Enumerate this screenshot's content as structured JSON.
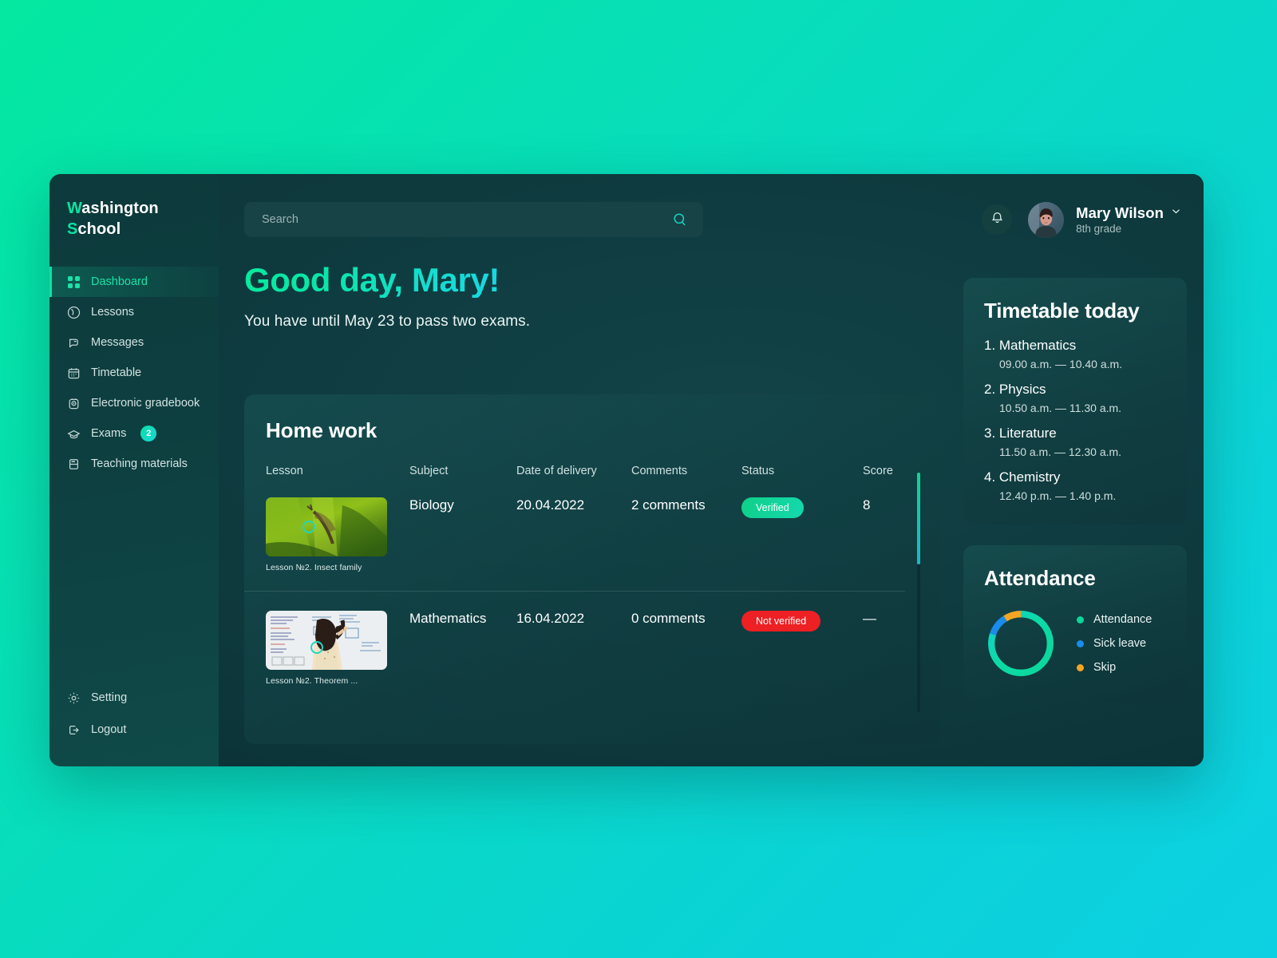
{
  "brand": {
    "line1": "Washington",
    "line2": "School",
    "accent1": "W",
    "accent2": "S",
    "accent_color": "#07e5a4"
  },
  "sidebar": {
    "items": [
      {
        "label": "Dashboard",
        "icon": "grid-icon",
        "active": true
      },
      {
        "label": "Lessons",
        "icon": "lessons-icon",
        "active": false
      },
      {
        "label": "Messages",
        "icon": "message-icon",
        "active": false
      },
      {
        "label": "Timetable",
        "icon": "calendar-icon",
        "active": false
      },
      {
        "label": "Electronic gradebook",
        "icon": "gradebook-icon",
        "active": false
      },
      {
        "label": "Exams",
        "icon": "graduation-cap-icon",
        "active": false,
        "badge": "2"
      },
      {
        "label": "Teaching materials",
        "icon": "book-icon",
        "active": false
      }
    ],
    "bottom_items": [
      {
        "label": "Setting",
        "icon": "gear-icon"
      },
      {
        "label": "Logout",
        "icon": "logout-icon"
      }
    ]
  },
  "search": {
    "placeholder": "Search",
    "value": "",
    "icon": "search-icon"
  },
  "header": {
    "bell_icon": "bell-icon",
    "user": {
      "name": "Mary Wilson",
      "grade": "8th grade",
      "chevron": "chevron-down-icon",
      "avatar": "avatar"
    }
  },
  "greeting": {
    "title": "Good day, Mary!",
    "subtitle": "You have until May 23 to pass two exams."
  },
  "homework": {
    "title": "Home work",
    "columns": [
      "Lesson",
      "Subject",
      "Date of delivery",
      "Comments",
      "Status",
      "Score"
    ],
    "rows": [
      {
        "lesson_caption": "Lesson №2. Insect family",
        "lesson_thumb": "insect-photo",
        "subject": "Biology",
        "date": "20.04.2022",
        "comments": "2 comments",
        "status": "Verified",
        "status_kind": "verified",
        "score": "8"
      },
      {
        "lesson_caption": "Lesson №2. Theorem ...",
        "lesson_thumb": "whiteboard-photo",
        "subject": "Mathematics",
        "date": "16.04.2022",
        "comments": "0 comments",
        "status": "Not verified",
        "status_kind": "notverified",
        "score": "—"
      }
    ]
  },
  "timetable": {
    "title": "Timetable today",
    "items": [
      {
        "name": "1. Mathematics",
        "time": "09.00 a.m. — 10.40 a.m."
      },
      {
        "name": "2. Physics",
        "time": "10.50 a.m. — 11.30 a.m."
      },
      {
        "name": "3. Literature",
        "time": "11.50 a.m. — 12.30 a.m."
      },
      {
        "name": "4. Chemistry",
        "time": "12.40 p.m. — 1.40 p.m."
      }
    ]
  },
  "attendance": {
    "title": "Attendance",
    "legend": [
      {
        "label": "Attendance",
        "color": "#0bd79a"
      },
      {
        "label": "Sick leave",
        "color": "#1a8ceb"
      },
      {
        "label": "Skip",
        "color": "#f5a524"
      }
    ]
  },
  "colors": {
    "accent_green": "#07e5a4",
    "accent_cyan": "#17d9e2",
    "panel": "#0e3a3e",
    "sidebar": "#0e4140",
    "danger": "#ed2024",
    "success": "#10cf87"
  },
  "chart_data": {
    "type": "pie",
    "title": "Attendance",
    "labels": [
      "Attendance",
      "Sick leave",
      "Skip"
    ],
    "values": [
      80,
      11,
      9
    ],
    "colors": [
      "#0bd79a",
      "#1a8ceb",
      "#f5a524"
    ],
    "donut": true,
    "inner_radius_ratio": 0.78,
    "start_angle": -90,
    "legend": "right",
    "grid": false
  }
}
